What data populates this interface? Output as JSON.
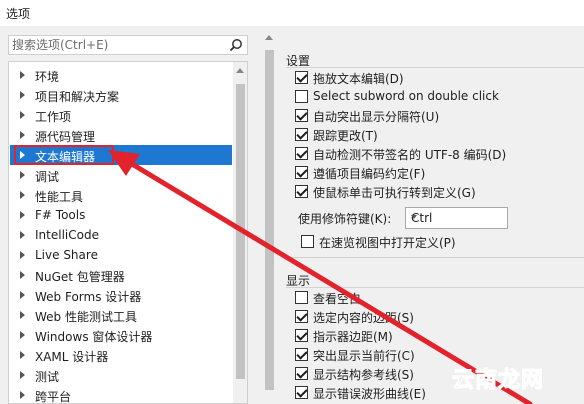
{
  "window": {
    "title": "选项"
  },
  "search": {
    "placeholder": "搜索选项(Ctrl+E)"
  },
  "tree": {
    "items": [
      {
        "label": "环境"
      },
      {
        "label": "项目和解决方案"
      },
      {
        "label": "工作项"
      },
      {
        "label": "源代码管理"
      },
      {
        "label": "文本编辑器",
        "selected": true
      },
      {
        "label": "调试"
      },
      {
        "label": "性能工具"
      },
      {
        "label": "F# Tools"
      },
      {
        "label": "IntelliCode"
      },
      {
        "label": "Live Share"
      },
      {
        "label": "NuGet 包管理器"
      },
      {
        "label": "Web Forms 设计器"
      },
      {
        "label": "Web 性能测试工具"
      },
      {
        "label": "Windows 窗体设计器"
      },
      {
        "label": "XAML 设计器"
      },
      {
        "label": "测试"
      },
      {
        "label": "跨平台"
      }
    ]
  },
  "settings": {
    "title": "设置",
    "options": [
      {
        "label": "拖放文本编辑(D)",
        "checked": true
      },
      {
        "label": "Select subword on double click",
        "checked": false
      },
      {
        "label": "自动突出显示分隔符(U)",
        "checked": true
      },
      {
        "label": "跟踪更改(T)",
        "checked": true
      },
      {
        "label": "自动检测不带签名的 UTF-8 编码(D)",
        "checked": true
      },
      {
        "label": "遵循项目编码约定(F)",
        "checked": true
      },
      {
        "label": "使鼠标单击可执行转到定义(G)",
        "checked": true
      }
    ],
    "modifier_label": "使用修饰符键(K):",
    "modifier_value": "Ctrl",
    "peek_label": "在速览视图中打开定义(P)",
    "peek_checked": false
  },
  "display": {
    "title": "显示",
    "options": [
      {
        "label": "查看空白",
        "checked": false
      },
      {
        "label": "选定内容的边距(S)",
        "checked": true
      },
      {
        "label": "指示器边距(M)",
        "checked": true
      },
      {
        "label": "突出显示当前行(C)",
        "checked": true
      },
      {
        "label": "显示结构参考线(S)",
        "checked": true
      },
      {
        "label": "显示错误波形曲线(E)",
        "checked": true
      }
    ]
  },
  "watermark": {
    "text": "云南龙网"
  },
  "colors": {
    "selection": "#1e78d2",
    "annotation": "#e3232b"
  }
}
